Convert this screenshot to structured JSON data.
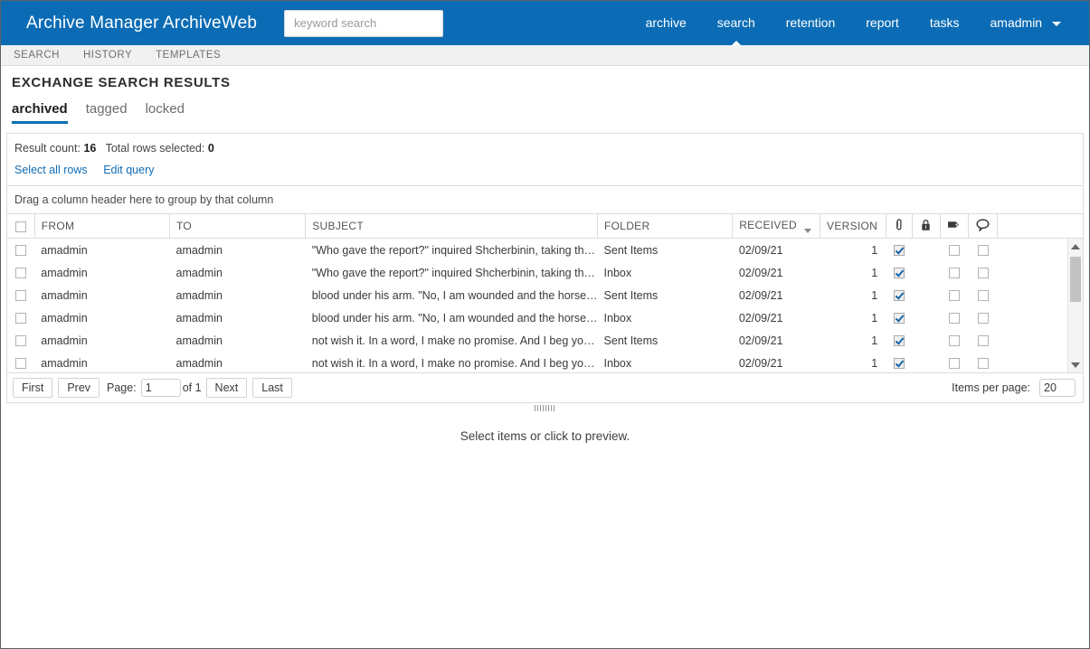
{
  "header": {
    "brand": "Archive Manager ArchiveWeb",
    "search_placeholder": "keyword search",
    "search_value": "",
    "nav": [
      {
        "label": "archive",
        "active": false,
        "caret": false
      },
      {
        "label": "search",
        "active": true,
        "caret": false
      },
      {
        "label": "retention",
        "active": false,
        "caret": false
      },
      {
        "label": "report",
        "active": false,
        "caret": false
      },
      {
        "label": "tasks",
        "active": false,
        "caret": false
      },
      {
        "label": "amadmin",
        "active": false,
        "caret": true
      }
    ],
    "accent_color": "#0b6cb5"
  },
  "subnav": {
    "items": [
      {
        "label": "SEARCH"
      },
      {
        "label": "HISTORY"
      },
      {
        "label": "TEMPLATES"
      }
    ]
  },
  "page": {
    "title": "EXCHANGE SEARCH RESULTS",
    "tabs": [
      {
        "label": "archived",
        "active": true
      },
      {
        "label": "tagged",
        "active": false
      },
      {
        "label": "locked",
        "active": false
      }
    ]
  },
  "summary": {
    "result_count_label": "Result count:",
    "result_count_value": "16",
    "selected_label": "Total rows selected:",
    "selected_value": "0",
    "select_all_link": "Select all rows",
    "edit_query_link": "Edit query"
  },
  "grid": {
    "group_hint": "Drag a column header here to group by that column",
    "header_checkbox_checked": false,
    "columns": [
      {
        "key": "select",
        "label": "",
        "icon": "select-all-checkbox"
      },
      {
        "key": "from",
        "label": "FROM"
      },
      {
        "key": "to",
        "label": "TO"
      },
      {
        "key": "subject",
        "label": "SUBJECT"
      },
      {
        "key": "folder",
        "label": "FOLDER"
      },
      {
        "key": "received",
        "label": "RECEIVED",
        "sorted": "desc"
      },
      {
        "key": "version",
        "label": "VERSION"
      },
      {
        "key": "attachment",
        "label": "",
        "icon": "paperclip-icon"
      },
      {
        "key": "locked",
        "label": "",
        "icon": "lock-icon"
      },
      {
        "key": "tag",
        "label": "",
        "icon": "tag-icon"
      },
      {
        "key": "note",
        "label": "",
        "icon": "comment-icon"
      },
      {
        "key": "spacer",
        "label": ""
      }
    ],
    "rows": [
      {
        "selected": false,
        "from": "amadmin",
        "to": "amadmin",
        "subject": "\"Who gave the report?\" inquired Shcherbinin, taking the ...",
        "folder": "Sent Items",
        "received": "02/09/21",
        "version": "1",
        "attachment": true,
        "locked": null,
        "tag": false,
        "note": false
      },
      {
        "selected": false,
        "from": "amadmin",
        "to": "amadmin",
        "subject": "\"Who gave the report?\" inquired Shcherbinin, taking the ...",
        "folder": "Inbox",
        "received": "02/09/21",
        "version": "1",
        "attachment": true,
        "locked": null,
        "tag": false,
        "note": false
      },
      {
        "selected": false,
        "from": "amadmin",
        "to": "amadmin",
        "subject": "blood under his arm. \"No, I am wounded and the horse i...",
        "folder": "Sent Items",
        "received": "02/09/21",
        "version": "1",
        "attachment": true,
        "locked": null,
        "tag": false,
        "note": false
      },
      {
        "selected": false,
        "from": "amadmin",
        "to": "amadmin",
        "subject": "blood under his arm. \"No, I am wounded and the horse i...",
        "folder": "Inbox",
        "received": "02/09/21",
        "version": "1",
        "attachment": true,
        "locked": null,
        "tag": false,
        "note": false
      },
      {
        "selected": false,
        "from": "amadmin",
        "to": "amadmin",
        "subject": "not wish it. In a word, I make no promise. And I beg you ...",
        "folder": "Sent Items",
        "received": "02/09/21",
        "version": "1",
        "attachment": true,
        "locked": null,
        "tag": false,
        "note": false
      },
      {
        "selected": false,
        "from": "amadmin",
        "to": "amadmin",
        "subject": "not wish it. In a word, I make no promise. And I beg you ...",
        "folder": "Inbox",
        "received": "02/09/21",
        "version": "1",
        "attachment": true,
        "locked": null,
        "tag": false,
        "note": false
      }
    ]
  },
  "pager": {
    "first": "First",
    "prev": "Prev",
    "page_label": "Page:",
    "page_value": "1",
    "of_label": "of 1",
    "next": "Next",
    "last": "Last",
    "items_per_page_label": "Items per page:",
    "items_per_page_value": "20"
  },
  "preview": {
    "message_prefix": "Select items",
    "message_middle": " or click ",
    "message_suffix": "to preview."
  }
}
